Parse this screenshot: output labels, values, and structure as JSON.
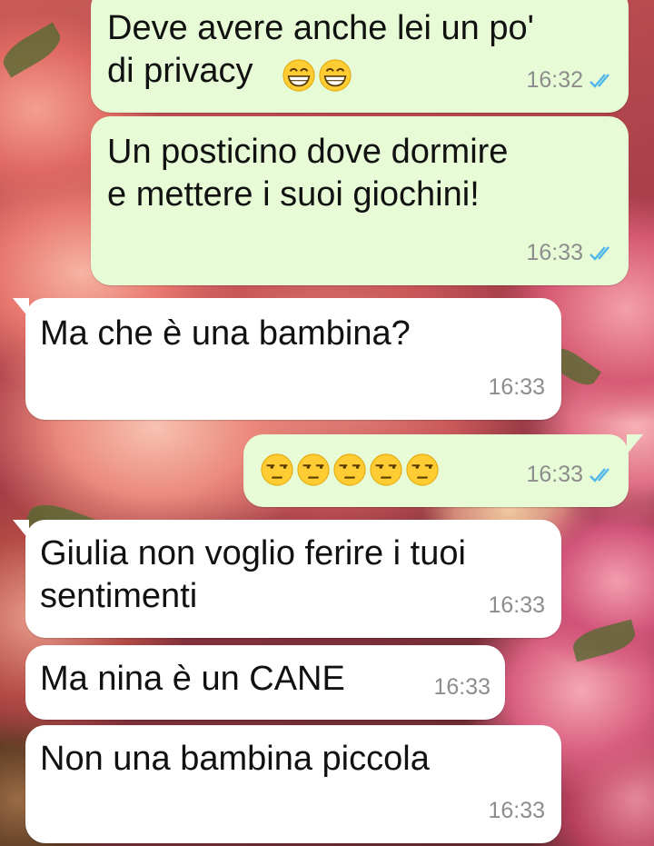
{
  "messages": [
    {
      "text": "Deve avere anche lei un po'\ndi privacy",
      "emoji_after": [
        "grinning-face-icon",
        "grinning-face-icon"
      ],
      "time": "16:32",
      "direction": "outgoing",
      "status": "read"
    },
    {
      "text": "Un posticino dove dormire\ne mettere i suoi giochini!",
      "time": "16:33",
      "direction": "outgoing",
      "status": "read"
    },
    {
      "text": "Ma che è una bambina?",
      "time": "16:33",
      "direction": "incoming"
    },
    {
      "emoji_only": [
        "unamused-face-icon",
        "unamused-face-icon",
        "unamused-face-icon",
        "unamused-face-icon",
        "unamused-face-icon"
      ],
      "time": "16:33",
      "direction": "outgoing",
      "status": "read"
    },
    {
      "text": "Giulia non voglio ferire i tuoi\nsentimenti",
      "time": "16:33",
      "direction": "incoming"
    },
    {
      "text": "Ma nina è un CANE",
      "time": "16:33",
      "direction": "incoming"
    },
    {
      "text": "Non una bambina piccola",
      "time": "16:33",
      "direction": "incoming"
    }
  ],
  "colors": {
    "outgoing_bubble": "#e7fcd6",
    "incoming_bubble": "#ffffff",
    "read_ticks": "#4fb6ec",
    "timestamp": "#8d8d8d"
  }
}
